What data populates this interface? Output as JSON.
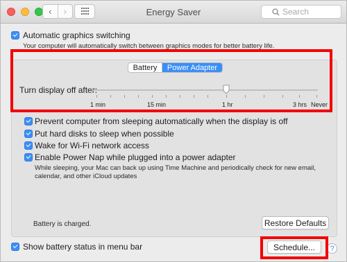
{
  "window": {
    "title": "Energy Saver",
    "back_glyph": "‹",
    "forward_glyph": "›"
  },
  "search": {
    "placeholder": "Search"
  },
  "graphics_switching": {
    "checked": true,
    "label": "Automatic graphics switching",
    "description": "Your computer will automatically switch between graphics modes for better battery life."
  },
  "tabs": {
    "items": [
      "Battery",
      "Power Adapter"
    ],
    "selected": "Power Adapter"
  },
  "display_off": {
    "label": "Turn display off after:",
    "value_label": "1 hr",
    "tick_labels": [
      "1 min",
      "15 min",
      "1 hr",
      "3 hrs",
      "Never"
    ]
  },
  "options": [
    {
      "checked": true,
      "label": "Prevent computer from sleeping automatically when the display is off"
    },
    {
      "checked": true,
      "label": "Put hard disks to sleep when possible"
    },
    {
      "checked": true,
      "label": "Wake for Wi-Fi network access"
    },
    {
      "checked": true,
      "label": "Enable Power Nap while plugged into a power adapter"
    }
  ],
  "power_nap_description": [
    "While sleeping, your Mac can back up using Time Machine and periodically check for new email,",
    "calendar, and other iCloud updates"
  ],
  "battery_status": "Battery is charged.",
  "buttons": {
    "restore_defaults": "Restore Defaults",
    "schedule": "Schedule...",
    "help": "?"
  },
  "menu_bar": {
    "checked": true,
    "label": "Show battery status in menu bar"
  },
  "colors": {
    "accent": "#3b8ef5",
    "highlight_box": "#f40000"
  }
}
